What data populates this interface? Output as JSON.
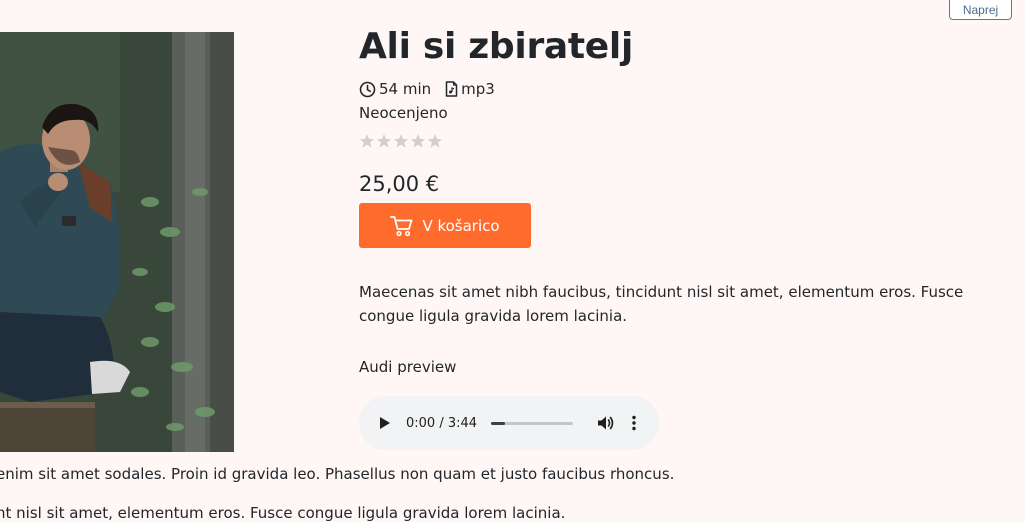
{
  "nav": {
    "next_label": "Naprej"
  },
  "product": {
    "title": "Ali si zbiratelj",
    "duration": "54 min",
    "format": "mp3",
    "rating_text": "Neocenjeno",
    "rating_value": 0,
    "rating_max": 5,
    "price": "25,00 €",
    "add_to_cart_label": "V košarico",
    "description": "Maecenas sit amet nibh faucibus, tincidunt nisl sit amet, elementum eros. Fusce congue ligula gravida lorem lacinia."
  },
  "audio": {
    "label": "Audi preview",
    "time": "0:00 / 3:44",
    "progress_fraction": 0.17
  },
  "long_description": {
    "line1": "enim sit amet sodales. Proin id gravida leo. Phasellus non quam et justo faucibus rhoncus.",
    "line2": "nt nisl sit amet, elementum eros. Fusce congue ligula gravida lorem lacinia."
  },
  "colors": {
    "accent": "#ff6b2c",
    "page_background": "#fff7f5",
    "star_empty": "#d0d0d0",
    "audio_background": "#f1f3f4"
  },
  "icons": {
    "duration": "clock-icon",
    "format": "file-audio-icon",
    "cart": "cart-icon",
    "play": "play-icon",
    "volume": "volume-icon",
    "more": "more-vertical-icon",
    "star": "star-icon"
  }
}
